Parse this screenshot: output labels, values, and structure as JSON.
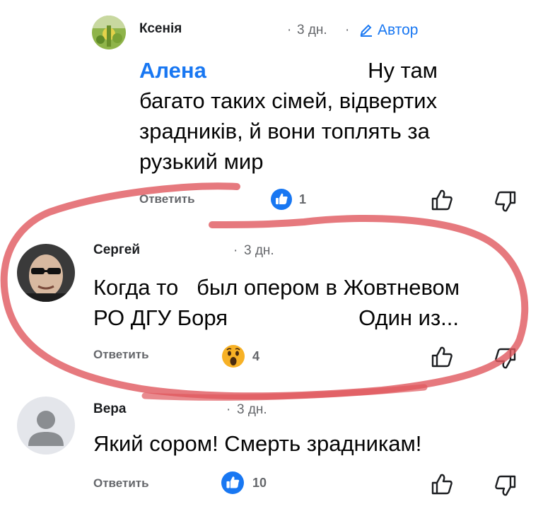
{
  "comments": [
    {
      "author": "Ксенія",
      "time": "3 дн.",
      "author_badge": "Автор",
      "mention": "Алена",
      "text_line1": "Ну там",
      "text_rest": [
        "багато таких сімей, відвертих",
        "зрадників, й вони топлять за",
        "рузький мир"
      ],
      "reply_label": "Ответить",
      "reaction": {
        "icon": "like-icon",
        "count": "1"
      }
    },
    {
      "author": "Сергей",
      "time": "3 дн.",
      "text_line1": "Когда то   был опером в Жовтневом",
      "text_line2a": "РО ДГУ Боря",
      "text_line2b": "Один из...",
      "reply_label": "Ответить",
      "reaction": {
        "icon": "wow-icon",
        "count": "4"
      }
    },
    {
      "author": "Вера",
      "time": "3 дн.",
      "text": "Який сором! Смерть зрадникам!",
      "reply_label": "Ответить",
      "reaction": {
        "icon": "like-icon",
        "count": "10"
      }
    }
  ],
  "colors": {
    "link": "#1877f2",
    "meta": "#65676b",
    "annotation": "#e0585e",
    "like": "#1877f2",
    "wow": "#f7b125"
  }
}
